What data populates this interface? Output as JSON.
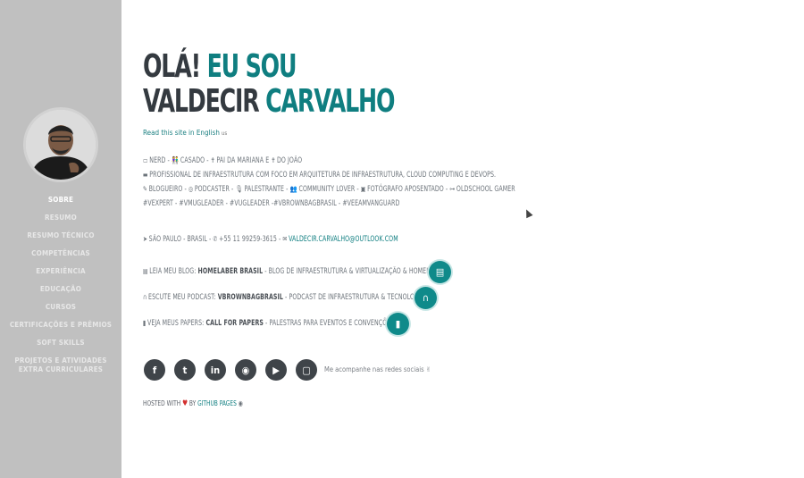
{
  "sidebar": {
    "items": [
      {
        "label": "SOBRE",
        "active": true
      },
      {
        "label": "RESUMO"
      },
      {
        "label": "RESUMO TÉCNICO"
      },
      {
        "label": "COMPETÊNCIAS"
      },
      {
        "label": "EXPERIÊNCIA"
      },
      {
        "label": "EDUCAÇÃO"
      },
      {
        "label": "CURSOS"
      },
      {
        "label": "CERTIFICAÇÕES E PRÊMIOS"
      },
      {
        "label": "SOFT SKILLS"
      },
      {
        "label": "PROJETOS E ATIVIDADES EXTRA CURRICULARES"
      }
    ]
  },
  "heading": {
    "line1_plain": "OLÁ! ",
    "line1_accent": "EU SOU",
    "line2_plain": "VALDECIR ",
    "line2_accent": "CARVALHO"
  },
  "english_link": {
    "text": "Read this site in English",
    "flag": "us"
  },
  "bio": {
    "line1": [
      "NERD",
      "CASADO",
      "PAI DA MARIANA E",
      "DO JOÃO"
    ],
    "line2": "PROFISSIONAL DE INFRAESTRUTURA COM FOCO EM ARQUITETURA DE INFRAESTRUTURA, CLOUD COMPUTING E DEVOPS.",
    "line3": [
      "BLOGUEIRO",
      "PODCASTER",
      "PALESTRANTE",
      "COMMUNITY LOVER",
      "FOTÓGRAFO APOSENTADO",
      "OLDSCHOOL GAMER"
    ],
    "line4": "#VEXPERT - #VMUGLEADER - #VUGLEADER -#VBROWNBAGBRASIL - #VEEAMVANGUARD"
  },
  "contact": {
    "location": "SÃO PAULO - BRASIL",
    "phone": "+55 11 99259-3615",
    "email": "VALDECIR.CARVALHO@OUTLOOK.COM"
  },
  "links": [
    {
      "prefix": "LEIA MEU BLOG:",
      "name": "HOMELABER BRASIL",
      "desc": " - BLOG DE INFRAESTRUTURA & VIRTUALIZAÇÃO & HOMELAB",
      "icon": "book-icon"
    },
    {
      "prefix": "ESCUTE MEU PODCAST:",
      "name": "VBROWNBAGBRASIL",
      "desc": " - PODCAST DE INFRAESTRUTURA & TECNOLOGIA",
      "icon": "podcast-icon"
    },
    {
      "prefix": "VEJA MEUS PAPERS:",
      "name": "CALL FOR PAPERS",
      "desc": " - PALESTRAS PARA EVENTOS E CONVENÇÕES",
      "icon": "file-icon"
    }
  ],
  "social": {
    "icons": [
      "facebook-icon",
      "twitter-icon",
      "linkedin-icon",
      "github-icon",
      "youtube-icon",
      "twitch-icon"
    ],
    "follow_text": "Me acompanhe nas redes sociais ✌"
  },
  "footer": {
    "hosted": "HOSTED WITH",
    "by": "BY",
    "link": "GITHUB PAGES"
  },
  "colors": {
    "accent": "#0f7e80",
    "sidebar": "#c0c0c0",
    "dark": "#343a40"
  }
}
